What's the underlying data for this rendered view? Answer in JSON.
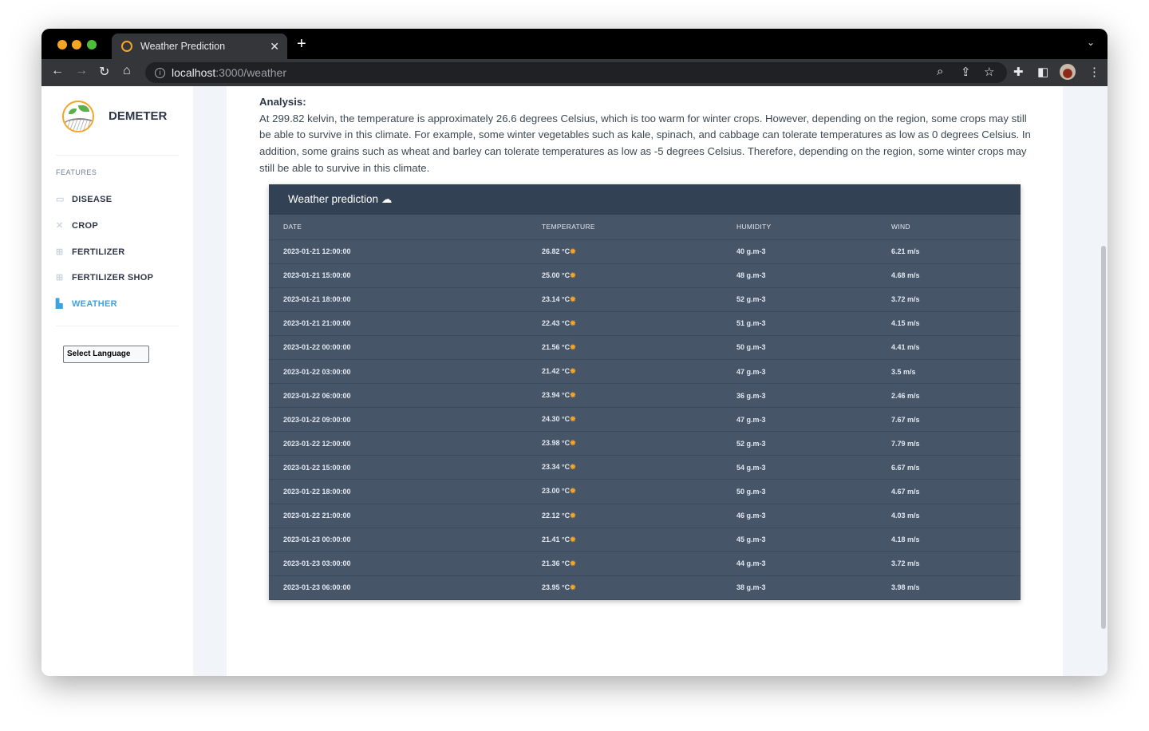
{
  "browser": {
    "tab_title": "Weather Prediction",
    "url_host": "localhost",
    "url_path": ":3000/weather"
  },
  "sidebar": {
    "brand": "DEMETER",
    "section": "FEATURES",
    "items": [
      {
        "label": "DISEASE",
        "icon": "monitor-icon"
      },
      {
        "label": "CROP",
        "icon": "tools-icon"
      },
      {
        "label": "FERTILIZER",
        "icon": "table-icon"
      },
      {
        "label": "FERTILIZER SHOP",
        "icon": "table-icon"
      },
      {
        "label": "WEATHER",
        "icon": "map-icon",
        "active": true
      }
    ],
    "language_select": "Select Language"
  },
  "analysis": {
    "heading": "Analysis:",
    "text": "At 299.82 kelvin, the temperature is approximately 26.6 degrees Celsius, which is too warm for winter crops. However, depending on the region, some crops may still be able to survive in this climate. For example, some winter vegetables such as kale, spinach, and cabbage can tolerate temperatures as low as 0 degrees Celsius. In addition, some grains such as wheat and barley can tolerate temperatures as low as -5 degrees Celsius. Therefore, depending on the region, some winter crops may still be able to survive in this climate."
  },
  "table": {
    "title": "Weather prediction",
    "title_icon": "cloud-icon",
    "columns": [
      "DATE",
      "TEMPERATURE",
      "HUMIDITY",
      "WIND"
    ],
    "rows": [
      [
        "2023-01-21 12:00:00",
        "26.82 °C",
        "40 g.m-3",
        "6.21 m/s"
      ],
      [
        "2023-01-21 15:00:00",
        "25.00 °C",
        "48 g.m-3",
        "4.68 m/s"
      ],
      [
        "2023-01-21 18:00:00",
        "23.14 °C",
        "52 g.m-3",
        "3.72 m/s"
      ],
      [
        "2023-01-21 21:00:00",
        "22.43 °C",
        "51 g.m-3",
        "4.15 m/s"
      ],
      [
        "2023-01-22 00:00:00",
        "21.56 °C",
        "50 g.m-3",
        "4.41 m/s"
      ],
      [
        "2023-01-22 03:00:00",
        "21.42 °C",
        "47 g.m-3",
        "3.5 m/s"
      ],
      [
        "2023-01-22 06:00:00",
        "23.94 °C",
        "36 g.m-3",
        "2.46 m/s"
      ],
      [
        "2023-01-22 09:00:00",
        "24.30 °C",
        "47 g.m-3",
        "7.67 m/s"
      ],
      [
        "2023-01-22 12:00:00",
        "23.98 °C",
        "52 g.m-3",
        "7.79 m/s"
      ],
      [
        "2023-01-22 15:00:00",
        "23.34 °C",
        "54 g.m-3",
        "6.67 m/s"
      ],
      [
        "2023-01-22 18:00:00",
        "23.00 °C",
        "50 g.m-3",
        "4.67 m/s"
      ],
      [
        "2023-01-22 21:00:00",
        "22.12 °C",
        "46 g.m-3",
        "4.03 m/s"
      ],
      [
        "2023-01-23 00:00:00",
        "21.41 °C",
        "45 g.m-3",
        "4.18 m/s"
      ],
      [
        "2023-01-23 03:00:00",
        "21.36 °C",
        "44 g.m-3",
        "3.72 m/s"
      ],
      [
        "2023-01-23 06:00:00",
        "23.95 °C",
        "38 g.m-3",
        "3.98 m/s"
      ]
    ]
  },
  "colors": {
    "accent": "#3da3e0",
    "table_header": "#334155",
    "table_body": "#475569",
    "sun": "#f5a524",
    "chat": "#2d3a8c"
  }
}
